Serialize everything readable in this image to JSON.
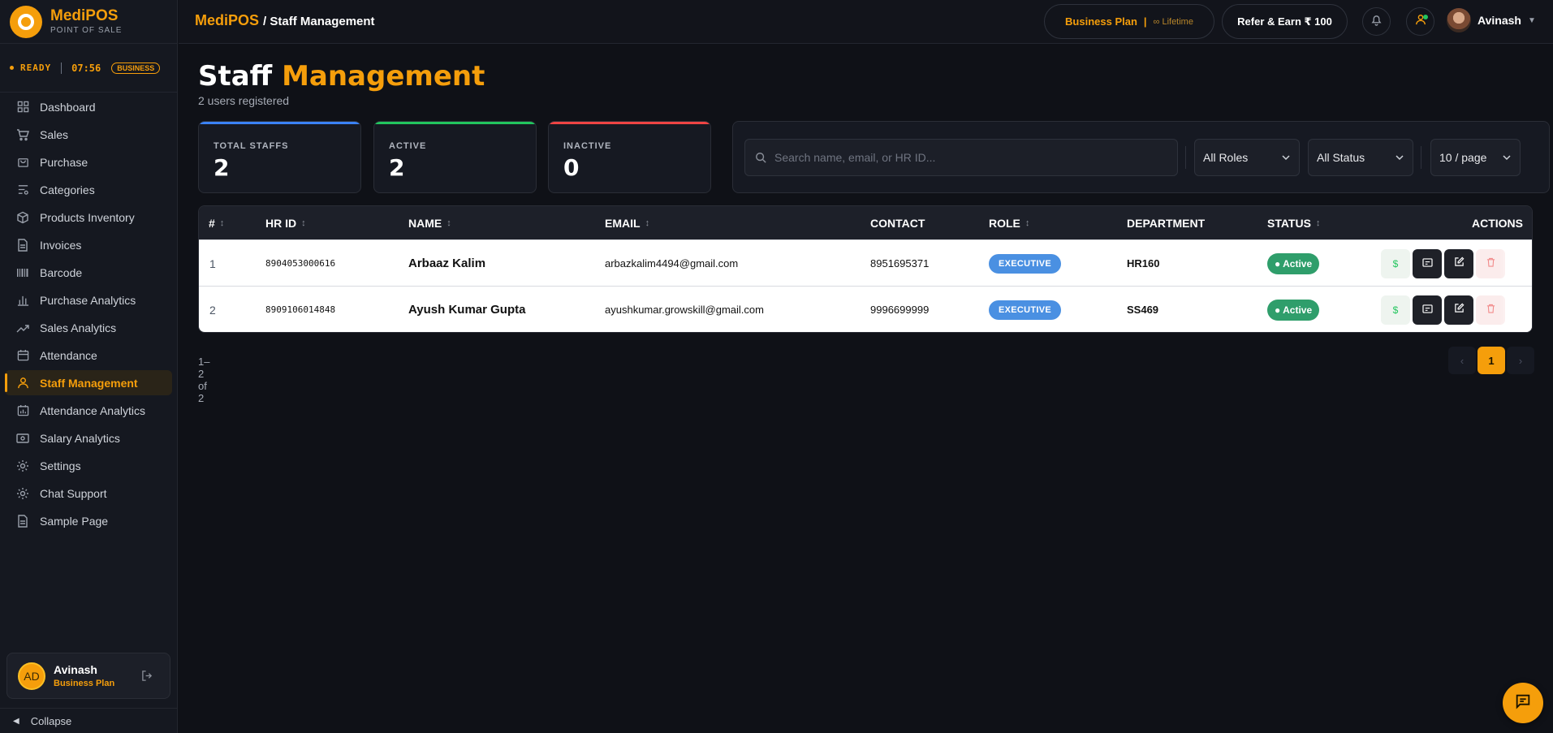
{
  "brand": {
    "name": "MediPOS",
    "subtitle": "POINT OF SALE",
    "logo_icon": "medipos-logo"
  },
  "status": {
    "state": "READY",
    "time": "07:56",
    "badge": "BUSINESS"
  },
  "sidebar": {
    "items": [
      {
        "label": "Dashboard",
        "icon": "grid-icon"
      },
      {
        "label": "Sales",
        "icon": "cart-icon"
      },
      {
        "label": "Purchase",
        "icon": "bag-icon"
      },
      {
        "label": "Categories",
        "icon": "filter-list-icon"
      },
      {
        "label": "Products Inventory",
        "icon": "box-icon"
      },
      {
        "label": "Invoices",
        "icon": "file-icon"
      },
      {
        "label": "Barcode",
        "icon": "barcode-icon"
      },
      {
        "label": "Purchase Analytics",
        "icon": "bar-chart-icon"
      },
      {
        "label": "Sales Analytics",
        "icon": "trending-up-icon"
      },
      {
        "label": "Attendance",
        "icon": "calendar-icon"
      },
      {
        "label": "Staff Management",
        "icon": "user-icon",
        "active": true
      },
      {
        "label": "Attendance Analytics",
        "icon": "calendar-chart-icon"
      },
      {
        "label": "Salary Analytics",
        "icon": "banknote-icon"
      },
      {
        "label": "Settings",
        "icon": "gear-icon"
      },
      {
        "label": "Chat Support",
        "icon": "gear-icon"
      },
      {
        "label": "Sample Page",
        "icon": "file-icon"
      }
    ],
    "user": {
      "initials": "AD",
      "name": "Avinash",
      "plan": "Business Plan"
    },
    "collapse_label": "Collapse"
  },
  "topbar": {
    "breadcrumb_app": "MediPOS",
    "breadcrumb_page": "/ Staff Management",
    "plan_label": "Business Plan",
    "plan_sep": "|",
    "plan_term": "∞ Lifetime",
    "refer_label": "Refer & Earn ₹ 100",
    "user_name": "Avinash"
  },
  "page": {
    "title_word1": "Staff",
    "title_word2": "Management",
    "subtitle": "2 users registered"
  },
  "stats": [
    {
      "label": "TOTAL STAFFS",
      "value": "2",
      "accent": "#3b82f6"
    },
    {
      "label": "ACTIVE",
      "value": "2",
      "accent": "#22c55e"
    },
    {
      "label": "INACTIVE",
      "value": "0",
      "accent": "#ef4444"
    }
  ],
  "filters": {
    "search_placeholder": "Search name, email, or HR ID...",
    "search_value": "",
    "role": "All Roles",
    "status": "All Status",
    "page_size": "10 / page"
  },
  "table": {
    "headers": {
      "num": "#",
      "hr_id": "HR ID",
      "name": "NAME",
      "email": "EMAIL",
      "contact": "CONTACT",
      "role": "ROLE",
      "department": "DEPARTMENT",
      "status": "STATUS",
      "actions": "ACTIONS"
    },
    "rows": [
      {
        "num": "1",
        "hr_id": "8904053000616",
        "name": "Arbaaz Kalim",
        "email": "arbazkalim4494@gmail.com",
        "contact": "8951695371",
        "role": "EXECUTIVE",
        "department": "HR160",
        "status": "● Active"
      },
      {
        "num": "2",
        "hr_id": "8909106014848",
        "name": "Ayush Kumar Gupta",
        "email": "ayushkumar.growskill@gmail.com",
        "contact": "9996699999",
        "role": "EXECUTIVE",
        "department": "SS469",
        "status": "● Active"
      }
    ]
  },
  "pagination": {
    "summary": "1–2 of 2",
    "prev": "‹",
    "current": "1",
    "next": "›"
  },
  "colors": {
    "accent": "#f59e0b",
    "role_badge": "#4a90e2",
    "active_badge": "#2f9e6b"
  }
}
